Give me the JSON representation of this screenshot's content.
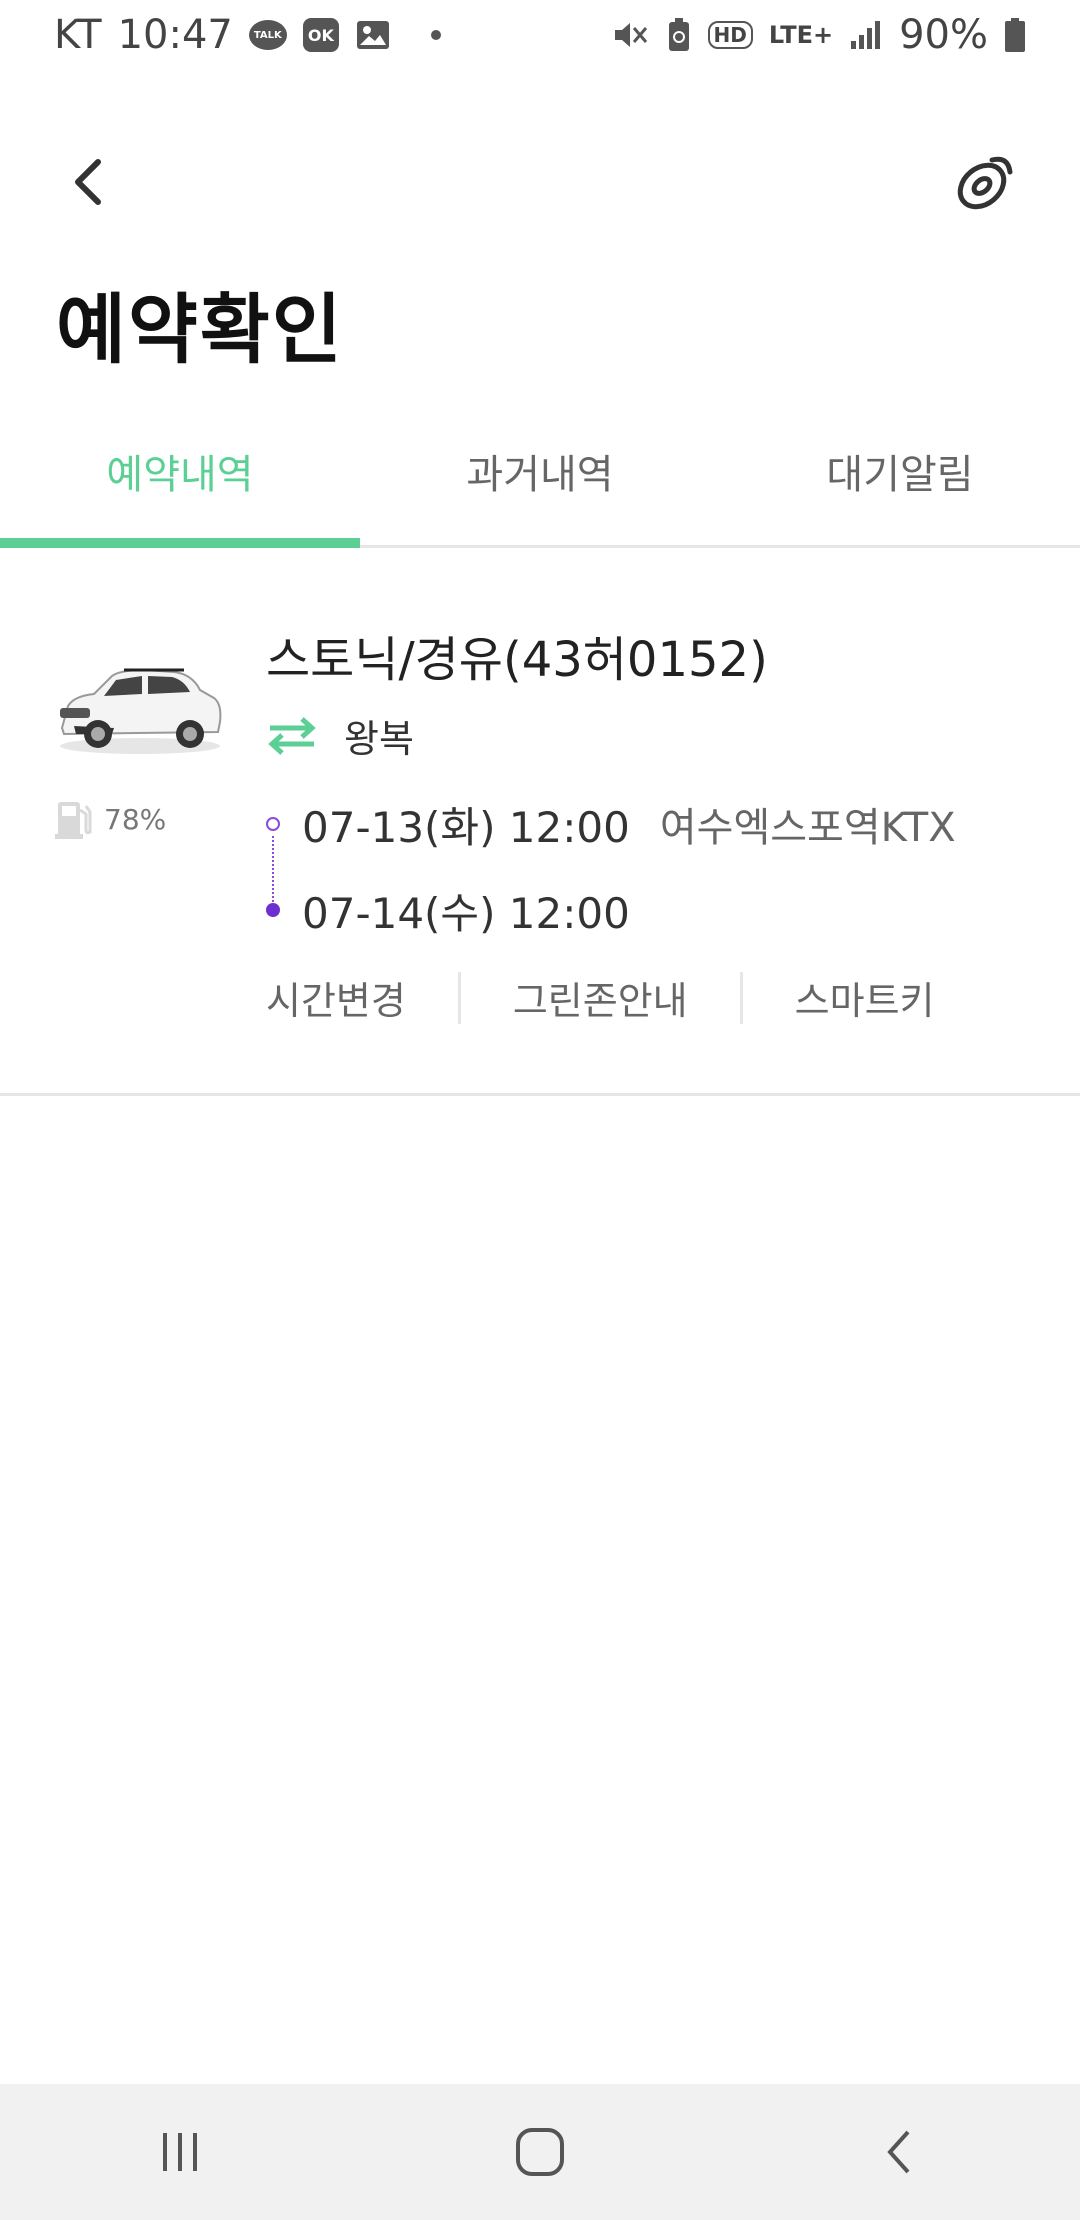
{
  "status_bar": {
    "carrier": "KT",
    "time": "10:47",
    "notifications": [
      "talk-icon",
      "ok-cashbag-icon",
      "gallery-icon",
      "dot-icon"
    ],
    "talk_badge": "TALK",
    "ok_badge": "OK",
    "system_icons": [
      "mute-icon",
      "battery-saver-icon",
      "hd-voice-icon",
      "lte-plus-icon",
      "signal-icon"
    ],
    "hd_label": "HD",
    "lte_label": "LTE+",
    "battery": "90%"
  },
  "header": {
    "back_icon": "chevron-left-icon",
    "right_icon": "sticker-icon"
  },
  "page_title": "예약확인",
  "tabs": [
    {
      "label": "예약내역",
      "active": true
    },
    {
      "label": "과거내역",
      "active": false
    },
    {
      "label": "대기알림",
      "active": false
    }
  ],
  "reservation": {
    "car_image": "white-suv-car",
    "fuel_level": "78%",
    "car_name": "스토닉/경유(43허0152)",
    "trip_type": "왕복",
    "start": {
      "date": "07-13(화) 12:00",
      "place": "여수엑스포역KTX"
    },
    "end": {
      "date": "07-14(수) 12:00"
    },
    "actions": [
      "시간변경",
      "그린존안내",
      "스마트키"
    ]
  },
  "colors": {
    "accent": "#5ccf94",
    "timeline": "#6e2fd0",
    "divider": "#e6e6e6"
  },
  "nav_bar": [
    "recent-apps-icon",
    "home-icon",
    "back-icon"
  ]
}
